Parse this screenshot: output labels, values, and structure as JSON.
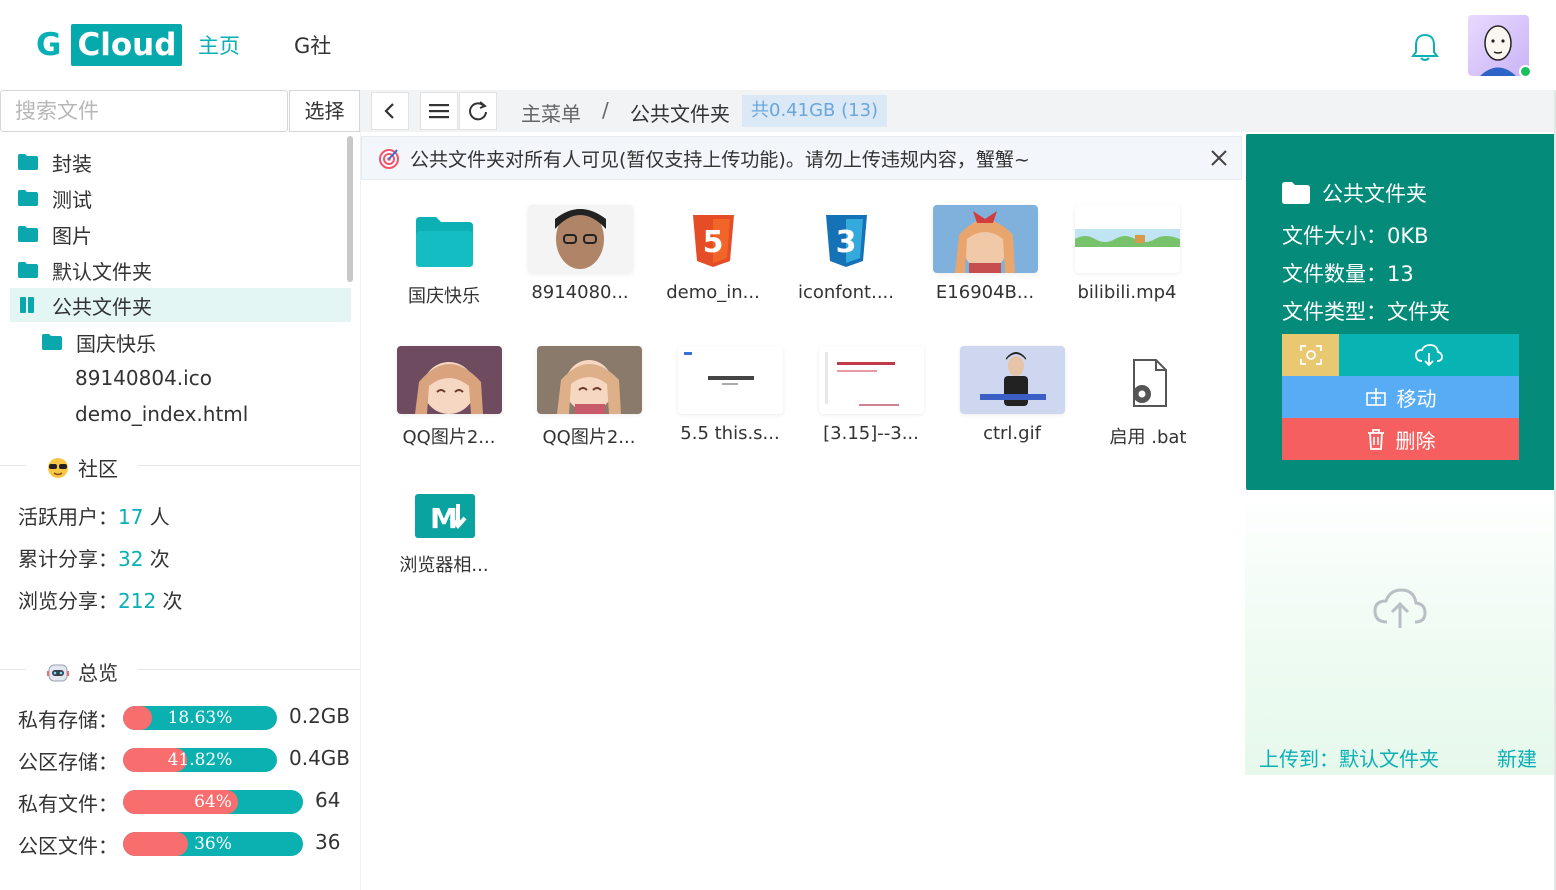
{
  "header": {
    "logo_g": "G",
    "logo_cloud": "Cloud",
    "nav_home": "主页",
    "nav_g": "G社",
    "accent": "#07b0b5"
  },
  "search": {
    "placeholder": "搜索文件",
    "select_label": "选择"
  },
  "tree": {
    "items": [
      {
        "label": "封装",
        "icon": "folder-icon"
      },
      {
        "label": "测试",
        "icon": "folder-icon"
      },
      {
        "label": "图片",
        "icon": "folder-icon"
      },
      {
        "label": "默认文件夹",
        "icon": "folder-icon"
      },
      {
        "label": "公共文件夹",
        "icon": "public-folder-icon",
        "active": true
      },
      {
        "label": "国庆快乐",
        "icon": "folder-icon"
      },
      {
        "label": "89140804.ico"
      },
      {
        "label": "demo_index.html"
      }
    ]
  },
  "community": {
    "title": "社区",
    "active_users_label": "活跃用户：",
    "active_users_value": "17",
    "active_users_unit": " 人",
    "shares_label": "累计分享：",
    "shares_value": "32",
    "shares_unit": " 次",
    "views_label": "浏览分享：",
    "views_value": "212",
    "views_unit": " 次"
  },
  "overview": {
    "title": "总览",
    "bars": [
      {
        "label": "私有存储：",
        "percent": 18.63,
        "percent_text": "18.63%",
        "value": "0.2GB"
      },
      {
        "label": "公区存储：",
        "percent": 41.82,
        "percent_text": "41.82%",
        "value": "0.4GB"
      },
      {
        "label": "私有文件：",
        "percent": 64,
        "percent_text": "64%",
        "value": "64"
      },
      {
        "label": "公区文件：",
        "percent": 36,
        "percent_text": "36%",
        "value": "36"
      }
    ]
  },
  "breadcrumb": {
    "root": "主菜单",
    "sep": "/",
    "current": "公共文件夹",
    "badge": "共0.41GB (13)"
  },
  "notice": {
    "text": "公共文件夹对所有人可见(暂仅支持上传功能)。请勿上传违规内容，蟹蟹~"
  },
  "files": [
    {
      "name": "国庆快乐",
      "kind": "folder"
    },
    {
      "name": "8914080...",
      "kind": "photo-boy"
    },
    {
      "name": "demo_in...",
      "kind": "html5"
    },
    {
      "name": "iconfont....",
      "kind": "css3"
    },
    {
      "name": "E16904B...",
      "kind": "anime-1"
    },
    {
      "name": "bilibili.mp4",
      "kind": "video"
    },
    {
      "name": "QQ图片2...",
      "kind": "anime-2"
    },
    {
      "name": "QQ图片2...",
      "kind": "anime-3"
    },
    {
      "name": "5.5 this.s...",
      "kind": "doc-1"
    },
    {
      "name": "[3.15]--3...",
      "kind": "doc-2"
    },
    {
      "name": "ctrl.gif",
      "kind": "person"
    },
    {
      "name": "启用 .bat",
      "kind": "bat"
    },
    {
      "name": "浏览器相...",
      "kind": "markdown"
    }
  ],
  "info": {
    "title": "公共文件夹",
    "size": "文件大小：0KB",
    "count": "文件数量：13",
    "type": "文件类型：文件夹",
    "move": "移动",
    "delete": "删除"
  },
  "upload": {
    "to": "上传到：默认文件夹",
    "new": "新建"
  }
}
